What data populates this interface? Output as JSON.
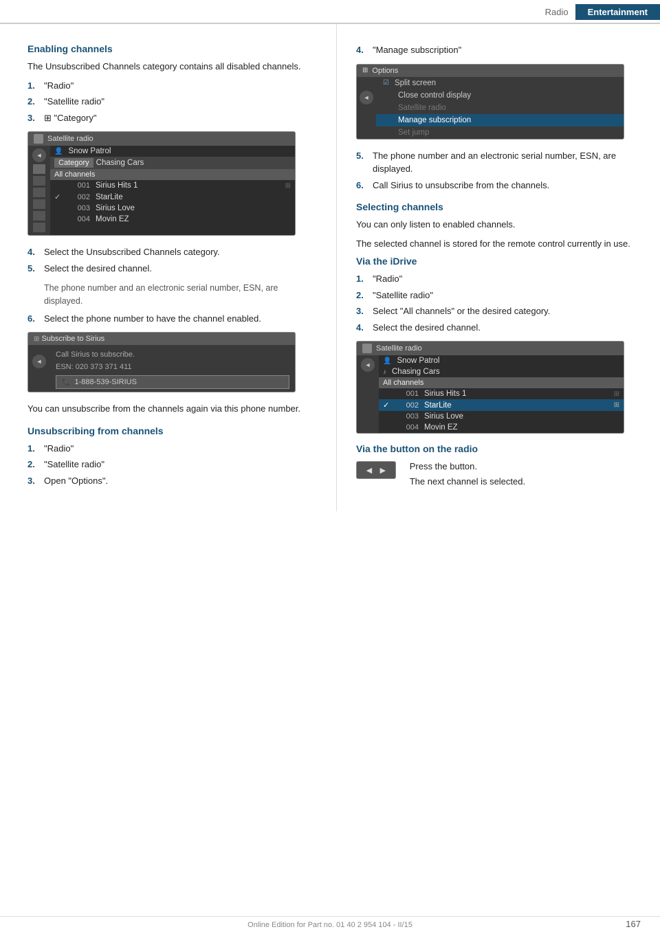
{
  "header": {
    "radio_label": "Radio",
    "entertainment_label": "Entertainment"
  },
  "left": {
    "enabling_channels": {
      "title": "Enabling channels",
      "intro": "The Unsubscribed Channels category contains all disabled channels.",
      "steps": [
        {
          "num": "1.",
          "text": "\"Radio\""
        },
        {
          "num": "2.",
          "text": "\"Satellite radio\""
        },
        {
          "num": "3.",
          "text": "⊞ \"Category\""
        },
        {
          "num": "4.",
          "text": "Select the Unsubscribed Channels category."
        },
        {
          "num": "5.",
          "text": "Select the desired channel."
        },
        {
          "num": "5sub",
          "text": "The phone number and an electronic serial number, ESN, are displayed."
        },
        {
          "num": "6.",
          "text": "Select the phone number to have the channel enabled."
        }
      ],
      "screenshot1": {
        "title": "Satellite radio",
        "rows": [
          {
            "type": "person",
            "label": "Snow Patrol"
          },
          {
            "type": "category",
            "label": "Chasing Cars"
          },
          {
            "type": "allchannels",
            "label": "All channels"
          },
          {
            "type": "channel",
            "num": "001",
            "name": "Sirius Hits 1",
            "check": ""
          },
          {
            "type": "channel",
            "num": "002",
            "name": "StarLite",
            "check": "✓"
          },
          {
            "type": "channel",
            "num": "003",
            "name": "Sirius Love",
            "check": ""
          },
          {
            "type": "channel",
            "num": "004",
            "name": "Movin EZ",
            "check": ""
          }
        ]
      },
      "screenshot2": {
        "title": "Subscribe to Sirius",
        "body1": "Call Sirius to subscribe.",
        "body2": "ESN: 020 373 371 411",
        "phone": "1-888-539-SIRIUS"
      },
      "unsubscribe_note": "You can unsubscribe from the channels again via this phone number."
    },
    "unsubscribing": {
      "title": "Unsubscribing from channels",
      "steps": [
        {
          "num": "1.",
          "text": "\"Radio\""
        },
        {
          "num": "2.",
          "text": "\"Satellite radio\""
        },
        {
          "num": "3.",
          "text": "Open \"Options\"."
        }
      ]
    }
  },
  "right": {
    "step4_label": "4.",
    "step4_text": "\"Manage subscription\"",
    "screenshot_options": {
      "title": "Options",
      "rows": [
        {
          "type": "check",
          "label": "Split screen"
        },
        {
          "type": "normal",
          "label": "Close control display"
        },
        {
          "type": "dim",
          "label": "Satellite radio"
        },
        {
          "type": "highlight",
          "label": "Manage subscription"
        },
        {
          "type": "dim",
          "label": "Set jump"
        }
      ]
    },
    "step5": {
      "num": "5.",
      "text": "The phone number and an electronic serial number, ESN, are displayed."
    },
    "step6": {
      "num": "6.",
      "text": "Call Sirius to unsubscribe from the channels."
    },
    "selecting_channels": {
      "title": "Selecting channels",
      "intro1": "You can only listen to enabled channels.",
      "intro2": "The selected channel is stored for the remote control currently in use.",
      "via_idrive": {
        "title": "Via the iDrive",
        "steps": [
          {
            "num": "1.",
            "text": "\"Radio\""
          },
          {
            "num": "2.",
            "text": "\"Satellite radio\""
          },
          {
            "num": "3.",
            "text": "Select \"All channels\" or the desired category."
          },
          {
            "num": "4.",
            "text": "Select the desired channel."
          }
        ],
        "screenshot": {
          "title": "Satellite radio",
          "rows": [
            {
              "type": "person",
              "label": "Snow Patrol"
            },
            {
              "type": "note",
              "label": "Chasing Cars"
            },
            {
              "type": "allchannels",
              "label": "All channels"
            },
            {
              "type": "channel",
              "num": "001",
              "name": "Sirius Hits 1",
              "check": ""
            },
            {
              "type": "channel_hl",
              "num": "002",
              "name": "StarLite",
              "check": "✓"
            },
            {
              "type": "channel",
              "num": "003",
              "name": "Sirius Love",
              "check": ""
            },
            {
              "type": "channel",
              "num": "004",
              "name": "Movin EZ",
              "check": ""
            }
          ]
        }
      },
      "via_button": {
        "title": "Via the button on the radio",
        "btn_label": "◄ ►",
        "text1": "Press the button.",
        "text2": "The next channel is selected."
      }
    }
  },
  "footer": {
    "text": "Online Edition for Part no. 01 40 2 954 104 - II/15",
    "page": "167"
  }
}
